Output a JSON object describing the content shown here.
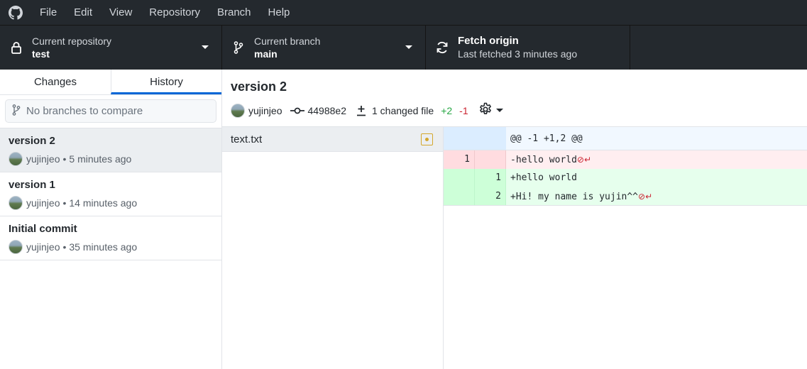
{
  "menu": [
    "File",
    "Edit",
    "View",
    "Repository",
    "Branch",
    "Help"
  ],
  "toolbar": {
    "repo": {
      "label": "Current repository",
      "value": "test"
    },
    "branch": {
      "label": "Current branch",
      "value": "main"
    },
    "fetch": {
      "title": "Fetch origin",
      "subtitle": "Last fetched 3 minutes ago"
    }
  },
  "sidebar": {
    "tabs": [
      {
        "label": "Changes"
      },
      {
        "label": "History"
      }
    ],
    "active_tab": "History",
    "compare_placeholder": "No branches to compare",
    "commits": [
      {
        "summary": "version 2",
        "author": "yujinjeo",
        "time": "5 minutes ago",
        "selected": true
      },
      {
        "summary": "version 1",
        "author": "yujinjeo",
        "time": "14 minutes ago"
      },
      {
        "summary": "Initial commit",
        "author": "yujinjeo",
        "time": "35 minutes ago"
      }
    ]
  },
  "commit": {
    "title": "version 2",
    "author": "yujinjeo",
    "sha": "44988e2",
    "changed_files": "1 changed file",
    "additions": "+2",
    "deletions": "-1"
  },
  "files": [
    {
      "name": "text.txt",
      "status": "modified"
    }
  ],
  "diff": {
    "hunk": "@@ -1 +1,2 @@",
    "lines": [
      {
        "type": "del",
        "old": "1",
        "new": "",
        "text": "-hello world",
        "noeol": true
      },
      {
        "type": "add",
        "old": "",
        "new": "1",
        "text": "+hello world",
        "noeol": false
      },
      {
        "type": "add",
        "old": "",
        "new": "2",
        "text": "+Hi! my name is yujin^^",
        "noeol": true
      }
    ]
  },
  "colors": {
    "menubar": "#24292e",
    "accent": "#0366d6",
    "added": "#28a745",
    "removed": "#cb2431"
  }
}
